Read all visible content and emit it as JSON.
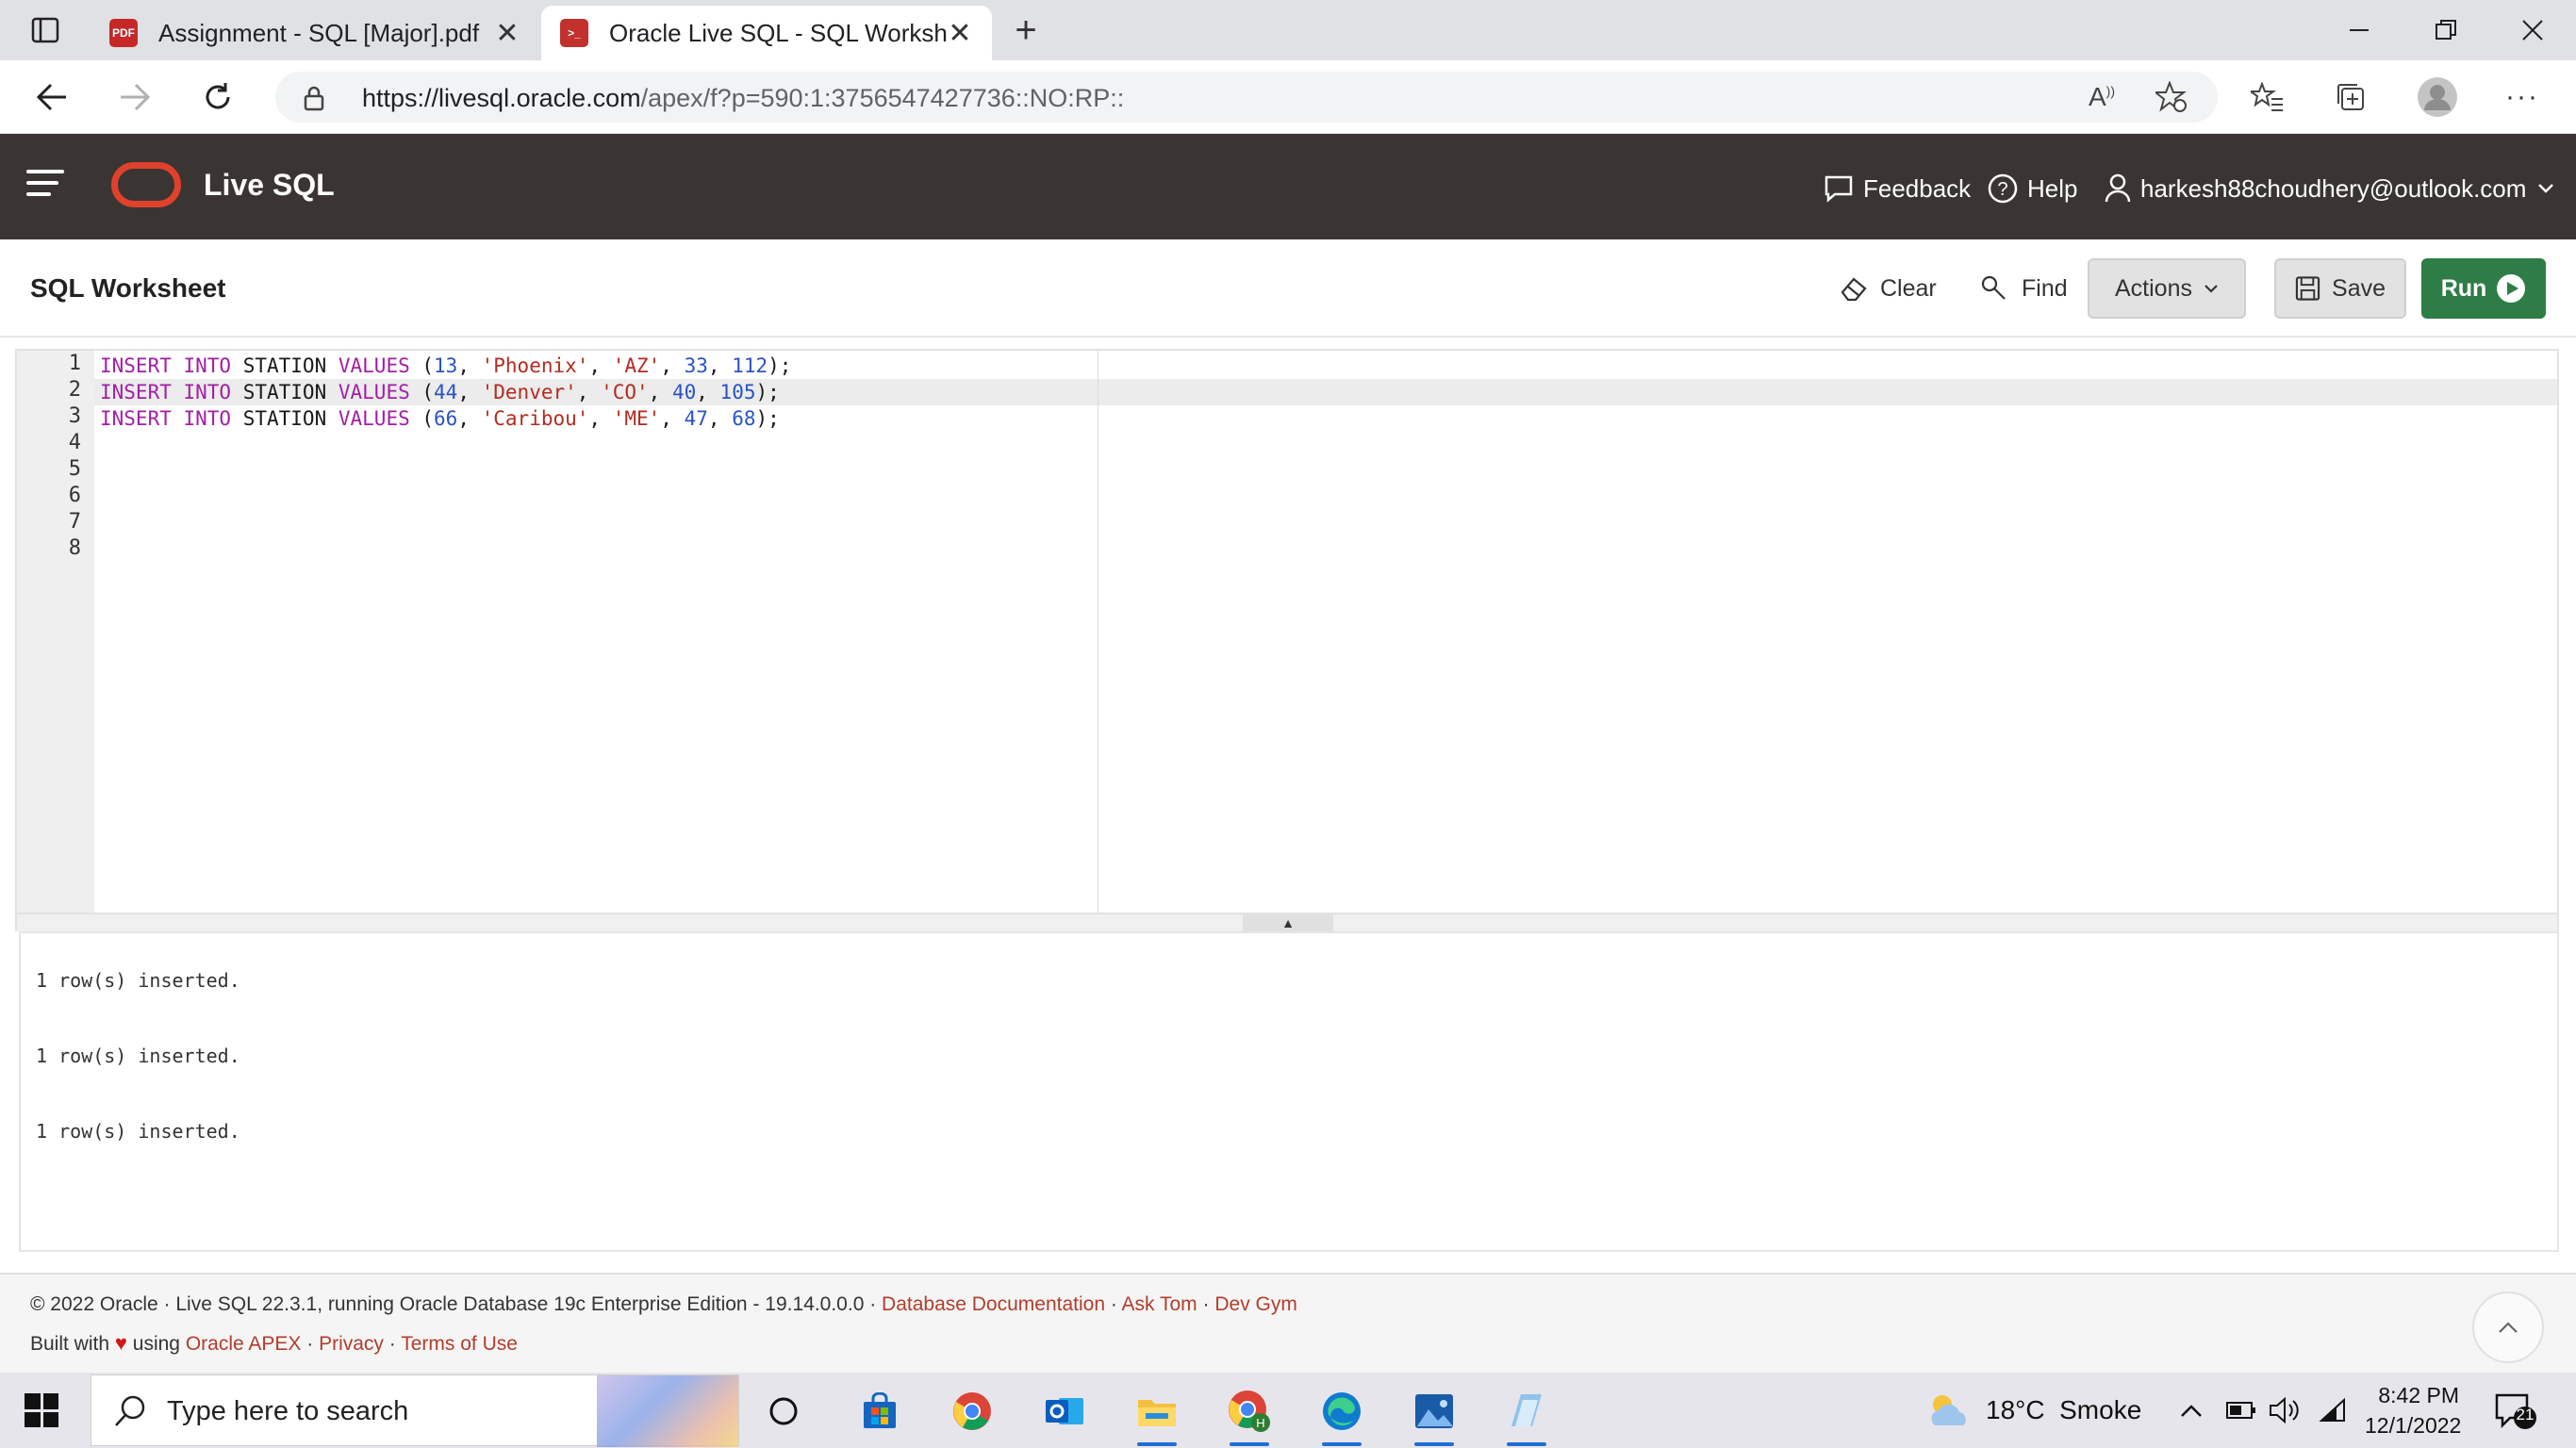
{
  "browser": {
    "tabs": [
      {
        "title": "Assignment - SQL [Major].pdf",
        "icon": "pdf-icon",
        "active": false
      },
      {
        "title": "Oracle Live SQL - SQL Workshee",
        "icon": "oracle-sql-icon",
        "active": true
      }
    ],
    "url_domain": "https://livesql.oracle.com",
    "url_path": "/apex/f?p=590:1:3756547427736::NO:RP::"
  },
  "app": {
    "name": "Live SQL",
    "header_links": {
      "feedback": "Feedback",
      "help": "Help",
      "user": "harkesh88choudhery@outlook.com"
    }
  },
  "worksheet": {
    "title": "SQL Worksheet",
    "buttons": {
      "clear": "Clear",
      "find": "Find",
      "actions": "Actions",
      "save": "Save",
      "run": "Run"
    },
    "line_numbers": [
      "1",
      "2",
      "3",
      "4",
      "5",
      "6",
      "7",
      "8"
    ],
    "active_line": 2,
    "code_lines": [
      [
        {
          "t": "INSERT INTO",
          "c": "kw"
        },
        {
          "t": " STATION ",
          "c": ""
        },
        {
          "t": "VALUES",
          "c": "kw"
        },
        {
          "t": " (",
          "c": ""
        },
        {
          "t": "13",
          "c": "num"
        },
        {
          "t": ", ",
          "c": ""
        },
        {
          "t": "'Phoenix'",
          "c": "str"
        },
        {
          "t": ", ",
          "c": ""
        },
        {
          "t": "'AZ'",
          "c": "str"
        },
        {
          "t": ", ",
          "c": ""
        },
        {
          "t": "33",
          "c": "num"
        },
        {
          "t": ", ",
          "c": ""
        },
        {
          "t": "112",
          "c": "num"
        },
        {
          "t": ");",
          "c": ""
        }
      ],
      [
        {
          "t": "INSERT INTO",
          "c": "kw"
        },
        {
          "t": " STATION ",
          "c": ""
        },
        {
          "t": "VALUES",
          "c": "kw"
        },
        {
          "t": " (",
          "c": ""
        },
        {
          "t": "44",
          "c": "num"
        },
        {
          "t": ", ",
          "c": ""
        },
        {
          "t": "'Denver'",
          "c": "str"
        },
        {
          "t": ", ",
          "c": ""
        },
        {
          "t": "'CO'",
          "c": "str"
        },
        {
          "t": ", ",
          "c": ""
        },
        {
          "t": "40",
          "c": "num"
        },
        {
          "t": ", ",
          "c": ""
        },
        {
          "t": "105",
          "c": "num"
        },
        {
          "t": ");",
          "c": ""
        }
      ],
      [
        {
          "t": "INSERT INTO",
          "c": "kw"
        },
        {
          "t": " STATION ",
          "c": ""
        },
        {
          "t": "VALUES",
          "c": "kw"
        },
        {
          "t": " (",
          "c": ""
        },
        {
          "t": "66",
          "c": "num"
        },
        {
          "t": ", ",
          "c": ""
        },
        {
          "t": "'Caribou'",
          "c": "str"
        },
        {
          "t": ", ",
          "c": ""
        },
        {
          "t": "'ME'",
          "c": "str"
        },
        {
          "t": ", ",
          "c": ""
        },
        {
          "t": "47",
          "c": "num"
        },
        {
          "t": ", ",
          "c": ""
        },
        {
          "t": "68",
          "c": "num"
        },
        {
          "t": ");",
          "c": ""
        }
      ]
    ],
    "output": [
      "1 row(s) inserted.",
      "1 row(s) inserted.",
      "1 row(s) inserted."
    ]
  },
  "footer": {
    "line1_text": "© 2022 Oracle · Live SQL 22.3.1, running Oracle Database 19c Enterprise Edition - 19.14.0.0.0 · ",
    "line1_links": [
      "Database Documentation",
      "Ask Tom",
      "Dev Gym"
    ],
    "built_with": "Built with",
    "using": "using",
    "line2_links": [
      "Oracle APEX",
      "Privacy",
      "Terms of Use"
    ],
    "separator": " · "
  },
  "taskbar": {
    "search_placeholder": "Type here to search",
    "weather": "18°C  Smoke",
    "time": "8:42 PM",
    "date": "12/1/2022",
    "notification_count": "21"
  },
  "colors": {
    "header_bg": "#3a3532",
    "oracle_red": "#e0412c",
    "run_green": "#2e7d46",
    "link_red": "#b13d2b"
  }
}
